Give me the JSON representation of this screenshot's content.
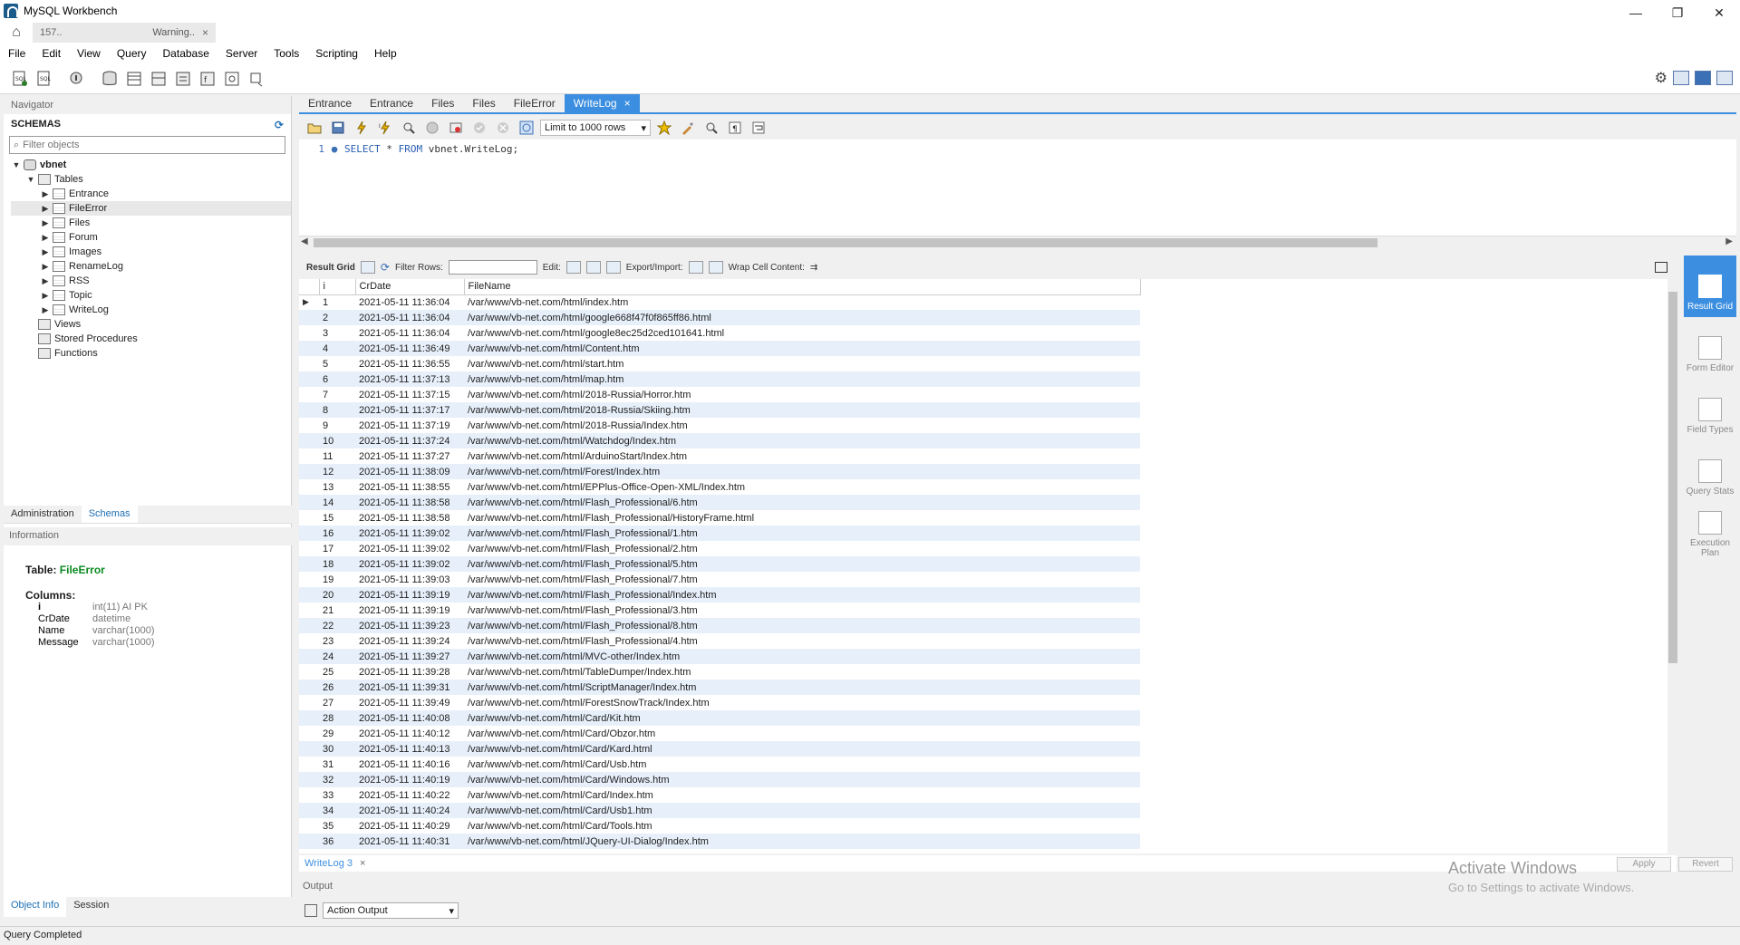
{
  "window": {
    "title": "MySQL Workbench",
    "minimize": "—",
    "restore": "❐",
    "close": "✕"
  },
  "connection_tab": {
    "host": "157..",
    "warning": "Warning..",
    "close": "×"
  },
  "menu": [
    "File",
    "Edit",
    "View",
    "Query",
    "Database",
    "Server",
    "Tools",
    "Scripting",
    "Help"
  ],
  "navigator": {
    "header": "Navigator",
    "schemas_label": "SCHEMAS",
    "filter_placeholder": "Filter objects",
    "schema": "vbnet",
    "tables_label": "Tables",
    "tables": [
      "Entrance",
      "FileError",
      "Files",
      "Forum",
      "Images",
      "RenameLog",
      "RSS",
      "Topic",
      "WriteLog"
    ],
    "selected_table": "FileError",
    "views_label": "Views",
    "procedures_label": "Stored Procedures",
    "functions_label": "Functions",
    "tabs": [
      "Administration",
      "Schemas"
    ],
    "info_label": "Information",
    "info": {
      "table_prefix": "Table:",
      "table_name": "FileError",
      "columns_label": "Columns:",
      "columns": [
        {
          "name": "i",
          "type": "int(11) AI PK"
        },
        {
          "name": "CrDate",
          "type": "datetime"
        },
        {
          "name": "Name",
          "type": "varchar(1000)"
        },
        {
          "name": "Message",
          "type": "varchar(1000)"
        }
      ]
    },
    "bottom_tabs": [
      "Object Info",
      "Session"
    ]
  },
  "editor_tabs": [
    "Entrance",
    "Entrance",
    "Files",
    "Files",
    "FileError",
    "WriteLog"
  ],
  "editor_tab_close": "×",
  "sql_toolbar": {
    "limit": "Limit to 1000 rows"
  },
  "sql": {
    "line_number": "1",
    "kw1": "SELECT",
    "mid1": " * ",
    "kw2": "FROM",
    "rest": " vbnet.WriteLog;"
  },
  "result_toolbar": {
    "result_grid": "Result Grid",
    "filter_rows": "Filter Rows:",
    "edit": "Edit:",
    "export_import": "Export/Import:",
    "wrap": "Wrap Cell Content:"
  },
  "grid": {
    "columns": [
      "i",
      "CrDate",
      "FileName"
    ],
    "rows": [
      [
        "1",
        "2021-05-11 11:36:04",
        "/var/www/vb-net.com/html/index.htm"
      ],
      [
        "2",
        "2021-05-11 11:36:04",
        "/var/www/vb-net.com/html/google668f47f0f865ff86.html"
      ],
      [
        "3",
        "2021-05-11 11:36:04",
        "/var/www/vb-net.com/html/google8ec25d2ced101641.html"
      ],
      [
        "4",
        "2021-05-11 11:36:49",
        "/var/www/vb-net.com/html/Content.htm"
      ],
      [
        "5",
        "2021-05-11 11:36:55",
        "/var/www/vb-net.com/html/start.htm"
      ],
      [
        "6",
        "2021-05-11 11:37:13",
        "/var/www/vb-net.com/html/map.htm"
      ],
      [
        "7",
        "2021-05-11 11:37:15",
        "/var/www/vb-net.com/html/2018-Russia/Horror.htm"
      ],
      [
        "8",
        "2021-05-11 11:37:17",
        "/var/www/vb-net.com/html/2018-Russia/Skiing.htm"
      ],
      [
        "9",
        "2021-05-11 11:37:19",
        "/var/www/vb-net.com/html/2018-Russia/Index.htm"
      ],
      [
        "10",
        "2021-05-11 11:37:24",
        "/var/www/vb-net.com/html/Watchdog/Index.htm"
      ],
      [
        "11",
        "2021-05-11 11:37:27",
        "/var/www/vb-net.com/html/ArduinoStart/Index.htm"
      ],
      [
        "12",
        "2021-05-11 11:38:09",
        "/var/www/vb-net.com/html/Forest/Index.htm"
      ],
      [
        "13",
        "2021-05-11 11:38:55",
        "/var/www/vb-net.com/html/EPPlus-Office-Open-XML/Index.htm"
      ],
      [
        "14",
        "2021-05-11 11:38:58",
        "/var/www/vb-net.com/html/Flash_Professional/6.htm"
      ],
      [
        "15",
        "2021-05-11 11:38:58",
        "/var/www/vb-net.com/html/Flash_Professional/HistoryFrame.html"
      ],
      [
        "16",
        "2021-05-11 11:39:02",
        "/var/www/vb-net.com/html/Flash_Professional/1.htm"
      ],
      [
        "17",
        "2021-05-11 11:39:02",
        "/var/www/vb-net.com/html/Flash_Professional/2.htm"
      ],
      [
        "18",
        "2021-05-11 11:39:02",
        "/var/www/vb-net.com/html/Flash_Professional/5.htm"
      ],
      [
        "19",
        "2021-05-11 11:39:03",
        "/var/www/vb-net.com/html/Flash_Professional/7.htm"
      ],
      [
        "20",
        "2021-05-11 11:39:19",
        "/var/www/vb-net.com/html/Flash_Professional/Index.htm"
      ],
      [
        "21",
        "2021-05-11 11:39:19",
        "/var/www/vb-net.com/html/Flash_Professional/3.htm"
      ],
      [
        "22",
        "2021-05-11 11:39:23",
        "/var/www/vb-net.com/html/Flash_Professional/8.htm"
      ],
      [
        "23",
        "2021-05-11 11:39:24",
        "/var/www/vb-net.com/html/Flash_Professional/4.htm"
      ],
      [
        "24",
        "2021-05-11 11:39:27",
        "/var/www/vb-net.com/html/MVC-other/Index.htm"
      ],
      [
        "25",
        "2021-05-11 11:39:28",
        "/var/www/vb-net.com/html/TableDumper/Index.htm"
      ],
      [
        "26",
        "2021-05-11 11:39:31",
        "/var/www/vb-net.com/html/ScriptManager/Index.htm"
      ],
      [
        "27",
        "2021-05-11 11:39:49",
        "/var/www/vb-net.com/html/ForestSnowTrack/Index.htm"
      ],
      [
        "28",
        "2021-05-11 11:40:08",
        "/var/www/vb-net.com/html/Card/Kit.htm"
      ],
      [
        "29",
        "2021-05-11 11:40:12",
        "/var/www/vb-net.com/html/Card/Obzor.htm"
      ],
      [
        "30",
        "2021-05-11 11:40:13",
        "/var/www/vb-net.com/html/Card/Kard.html"
      ],
      [
        "31",
        "2021-05-11 11:40:16",
        "/var/www/vb-net.com/html/Card/Usb.htm"
      ],
      [
        "32",
        "2021-05-11 11:40:19",
        "/var/www/vb-net.com/html/Card/Windows.htm"
      ],
      [
        "33",
        "2021-05-11 11:40:22",
        "/var/www/vb-net.com/html/Card/Index.htm"
      ],
      [
        "34",
        "2021-05-11 11:40:24",
        "/var/www/vb-net.com/html/Card/Usb1.htm"
      ],
      [
        "35",
        "2021-05-11 11:40:29",
        "/var/www/vb-net.com/html/Card/Tools.htm"
      ],
      [
        "36",
        "2021-05-11 11:40:31",
        "/var/www/vb-net.com/html/JQuery-UI-Dialog/Index.htm"
      ]
    ]
  },
  "side_panel": [
    "Result Grid",
    "Form Editor",
    "Field Types",
    "Query Stats",
    "Execution Plan"
  ],
  "result_tab": "WriteLog 3",
  "apply": "Apply",
  "revert": "Revert",
  "watermark": {
    "line1": "Activate Windows",
    "line2": "Go to Settings to activate Windows."
  },
  "output": {
    "label": "Output",
    "select": "Action Output"
  },
  "status": "Query Completed"
}
